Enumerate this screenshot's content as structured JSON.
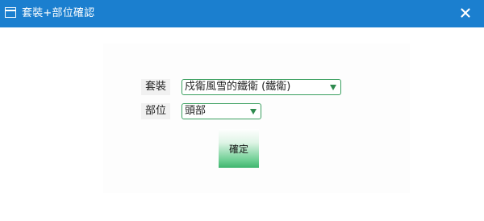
{
  "window": {
    "title": "套裝+部位確認",
    "close_symbol": "✕"
  },
  "form": {
    "set_label": "套裝",
    "set_value": "戍衛風雪的鐵衛 (鐵衛)",
    "part_label": "部位",
    "part_value": "頭部"
  },
  "confirm_label": "確定",
  "icons": {
    "window": "window-icon",
    "close": "close-icon",
    "dropdown": "chevron-down-icon"
  },
  "colors": {
    "titlebar": "#1b7fcf",
    "accent_green": "#3fb56e",
    "select_border": "#3a9f5f"
  }
}
